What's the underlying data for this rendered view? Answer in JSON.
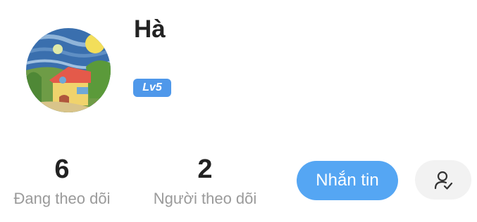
{
  "profile": {
    "username": "Hà",
    "level": "Lv5"
  },
  "stats": {
    "following_count": "6",
    "following_label": "Đang theo dõi",
    "followers_count": "2",
    "followers_label": "Người theo dõi"
  },
  "actions": {
    "message_label": "Nhắn tin",
    "follow_status_icon": "user-check-icon"
  },
  "colors": {
    "accent": "#55a6f3",
    "badge": "#4f98ea",
    "secondary_button_bg": "#f2f2f2",
    "muted_text": "#9a9a9a"
  }
}
